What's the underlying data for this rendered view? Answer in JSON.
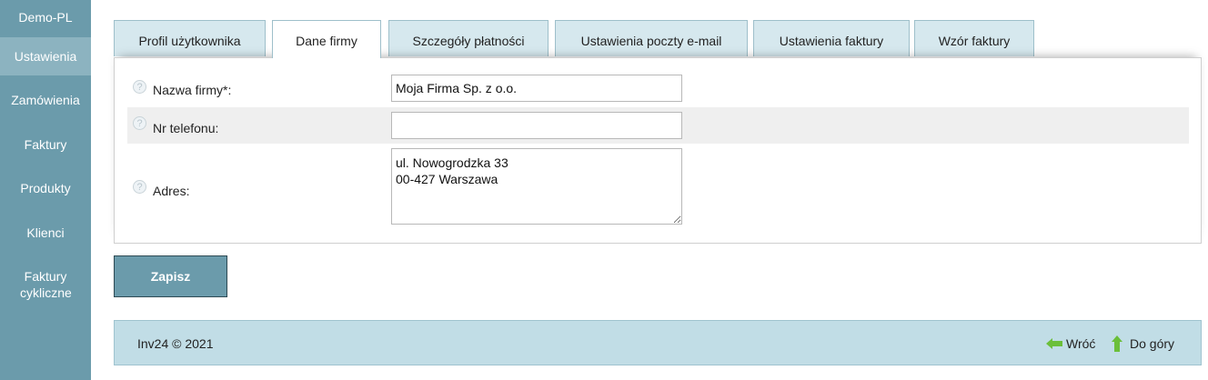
{
  "sidebar": {
    "header": "Demo-PL",
    "items": [
      {
        "label": "Ustawienia"
      },
      {
        "label": "Zamówienia"
      },
      {
        "label": "Faktury"
      },
      {
        "label": "Produkty"
      },
      {
        "label": "Klienci"
      },
      {
        "label": "Faktury cykliczne"
      }
    ]
  },
  "tabs": [
    {
      "label": "Profil użytkownika"
    },
    {
      "label": "Dane firmy"
    },
    {
      "label": "Szczegóły płatności"
    },
    {
      "label": "Ustawienia poczty e-mail"
    },
    {
      "label": "Ustawienia faktury"
    },
    {
      "label": "Wzór faktury"
    }
  ],
  "form": {
    "company_label": "Nazwa firmy*:",
    "company_value": "Moja Firma Sp. z o.o.",
    "phone_label": "Nr telefonu:",
    "phone_value": "",
    "address_label": "Adres:",
    "address_value": "ul. Nowogrodzka 33\n00-427 Warszawa",
    "help_glyph": "?"
  },
  "save_label": "Zapisz",
  "footer": {
    "copyright": "Inv24 © 2021",
    "back_label": "Wróć",
    "top_label": "Do góry"
  },
  "colors": {
    "sidebar": "#6b9bab",
    "sidebar_active": "#8cb3c0",
    "tab": "#d6e8ee",
    "footer": "#c1dde6",
    "arrow": "#6bbf3a"
  }
}
